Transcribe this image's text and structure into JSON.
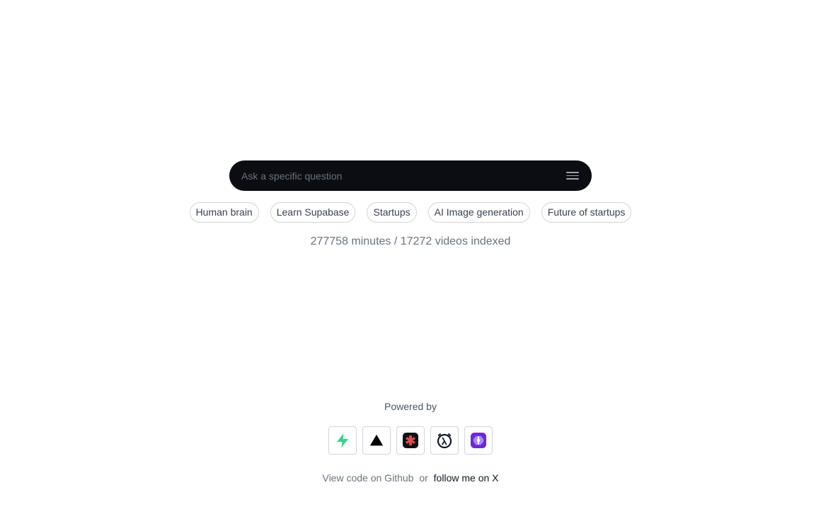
{
  "search": {
    "placeholder": "Ask a specific question",
    "value": "",
    "menu_icon": "menu-icon"
  },
  "suggestions": [
    "Human brain",
    "Learn Supabase",
    "Startups",
    "AI Image generation",
    "Future of startups"
  ],
  "stats": {
    "text": "277758 minutes / 17272 videos indexed"
  },
  "powered_by": {
    "label": "Powered by",
    "logos": [
      {
        "icon": "supabase-icon",
        "color": "#3ecf8e"
      },
      {
        "icon": "vercel-icon",
        "color": "#000000"
      },
      {
        "icon": "red-puzzle-icon",
        "color": "#e5484d"
      },
      {
        "icon": "lambda-clock-icon",
        "color": "#111827"
      },
      {
        "icon": "purple-brain-icon",
        "color": "#7c3aed"
      }
    ]
  },
  "footer": {
    "github_text": "View code on Github",
    "separator": "or",
    "x_text": "follow me on X"
  }
}
